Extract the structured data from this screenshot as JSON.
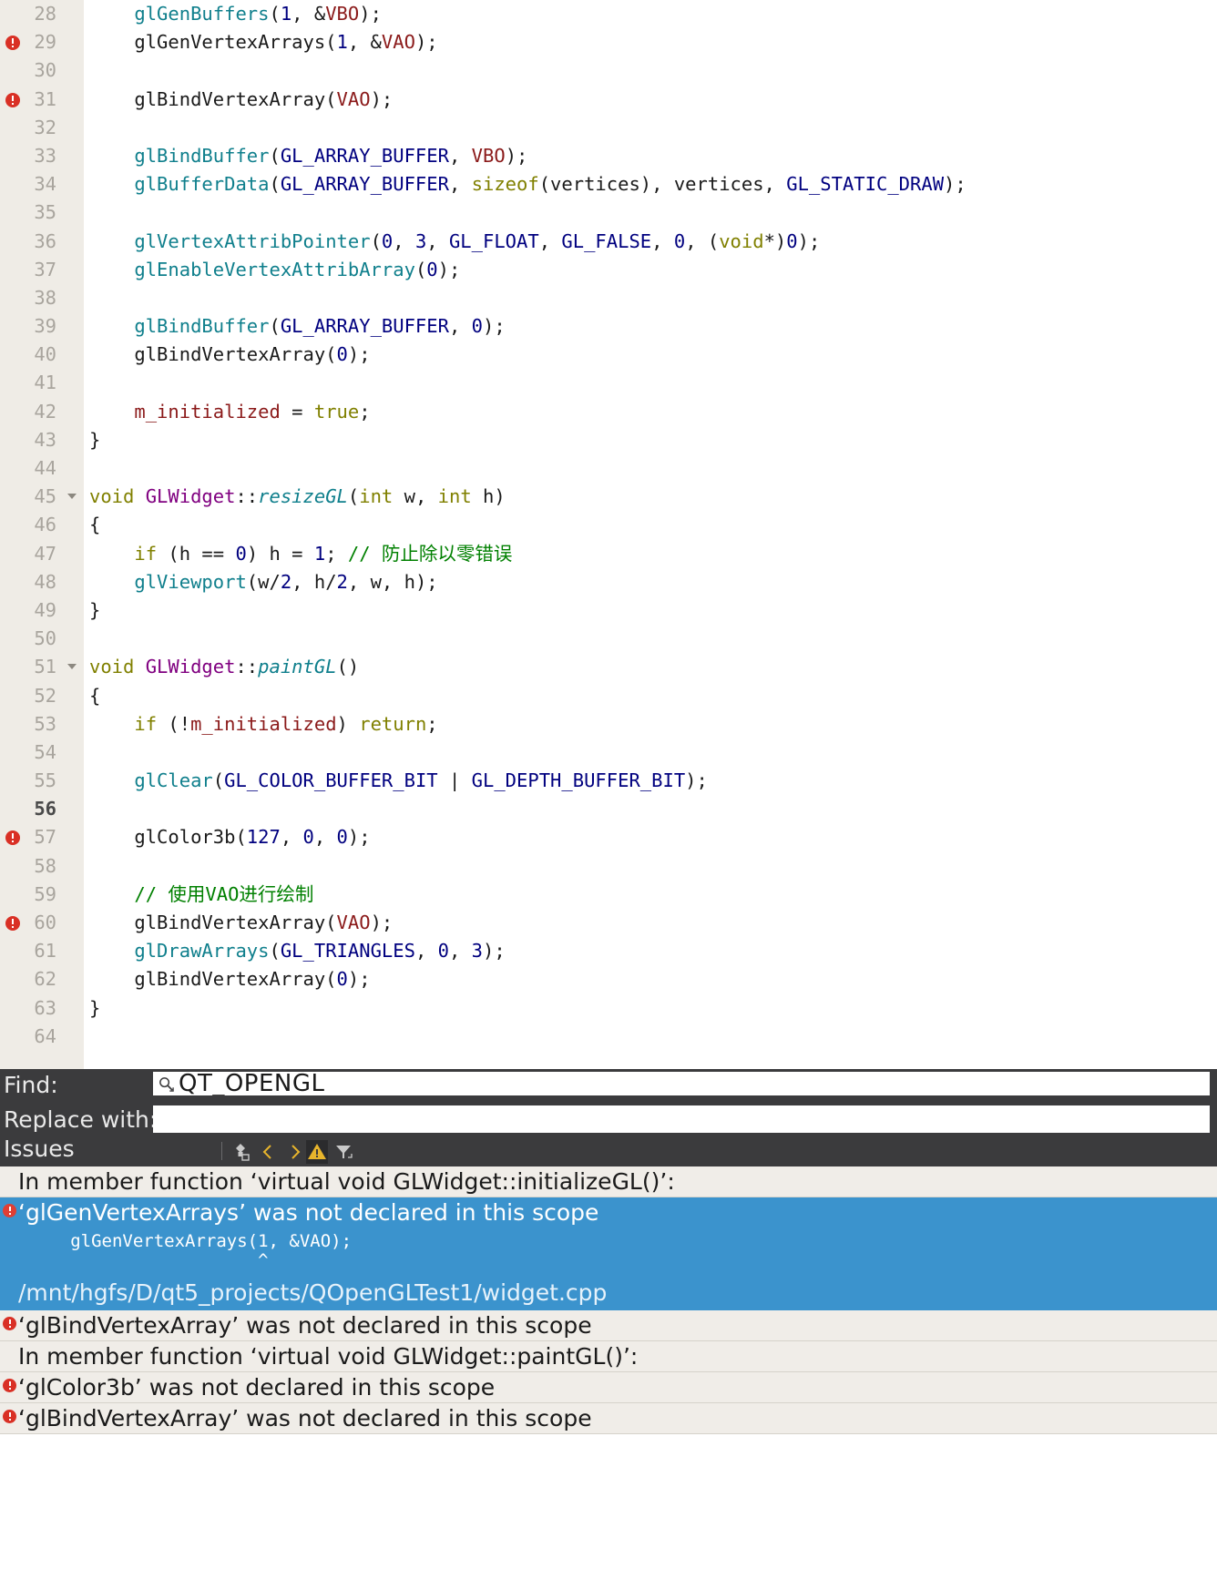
{
  "editor": {
    "first_line": 28,
    "current_line": 56,
    "error_lines": [
      29,
      31,
      57,
      60
    ],
    "fold_lines": [
      45,
      51
    ],
    "lines": [
      {
        "n": 28,
        "segs": [
          {
            "t": "    ",
            "c": "pl"
          },
          {
            "t": "glGenBuffers",
            "c": "gl"
          },
          {
            "t": "(",
            "c": "pl"
          },
          {
            "t": "1",
            "c": "num"
          },
          {
            "t": ", &",
            "c": "pl"
          },
          {
            "t": "VBO",
            "c": "var"
          },
          {
            "t": ");",
            "c": "pl"
          }
        ]
      },
      {
        "n": 29,
        "segs": [
          {
            "t": "    glGenVertexArrays(",
            "c": "pl"
          },
          {
            "t": "1",
            "c": "num"
          },
          {
            "t": ", &",
            "c": "pl"
          },
          {
            "t": "VAO",
            "c": "var"
          },
          {
            "t": ");",
            "c": "pl"
          }
        ]
      },
      {
        "n": 30,
        "segs": []
      },
      {
        "n": 31,
        "segs": [
          {
            "t": "    glBindVertexArray(",
            "c": "pl"
          },
          {
            "t": "VAO",
            "c": "var"
          },
          {
            "t": ");",
            "c": "pl"
          }
        ]
      },
      {
        "n": 32,
        "segs": []
      },
      {
        "n": 33,
        "segs": [
          {
            "t": "    ",
            "c": "pl"
          },
          {
            "t": "glBindBuffer",
            "c": "gl"
          },
          {
            "t": "(",
            "c": "pl"
          },
          {
            "t": "GL_ARRAY_BUFFER",
            "c": "mac"
          },
          {
            "t": ", ",
            "c": "pl"
          },
          {
            "t": "VBO",
            "c": "var"
          },
          {
            "t": ");",
            "c": "pl"
          }
        ]
      },
      {
        "n": 34,
        "segs": [
          {
            "t": "    ",
            "c": "pl"
          },
          {
            "t": "glBufferData",
            "c": "gl"
          },
          {
            "t": "(",
            "c": "pl"
          },
          {
            "t": "GL_ARRAY_BUFFER",
            "c": "mac"
          },
          {
            "t": ", ",
            "c": "pl"
          },
          {
            "t": "sizeof",
            "c": "k"
          },
          {
            "t": "(vertices), vertices, ",
            "c": "pl"
          },
          {
            "t": "GL_STATIC_DRAW",
            "c": "mac"
          },
          {
            "t": ");",
            "c": "pl"
          }
        ]
      },
      {
        "n": 35,
        "segs": []
      },
      {
        "n": 36,
        "segs": [
          {
            "t": "    ",
            "c": "pl"
          },
          {
            "t": "glVertexAttribPointer",
            "c": "gl"
          },
          {
            "t": "(",
            "c": "pl"
          },
          {
            "t": "0",
            "c": "num"
          },
          {
            "t": ", ",
            "c": "pl"
          },
          {
            "t": "3",
            "c": "num"
          },
          {
            "t": ", ",
            "c": "pl"
          },
          {
            "t": "GL_FLOAT",
            "c": "mac"
          },
          {
            "t": ", ",
            "c": "pl"
          },
          {
            "t": "GL_FALSE",
            "c": "mac"
          },
          {
            "t": ", ",
            "c": "pl"
          },
          {
            "t": "0",
            "c": "num"
          },
          {
            "t": ", (",
            "c": "pl"
          },
          {
            "t": "void",
            "c": "cast"
          },
          {
            "t": "*)",
            "c": "pl"
          },
          {
            "t": "0",
            "c": "num"
          },
          {
            "t": ");",
            "c": "pl"
          }
        ]
      },
      {
        "n": 37,
        "segs": [
          {
            "t": "    ",
            "c": "pl"
          },
          {
            "t": "glEnableVertexAttribArray",
            "c": "gl"
          },
          {
            "t": "(",
            "c": "pl"
          },
          {
            "t": "0",
            "c": "num"
          },
          {
            "t": ");",
            "c": "pl"
          }
        ]
      },
      {
        "n": 38,
        "segs": []
      },
      {
        "n": 39,
        "segs": [
          {
            "t": "    ",
            "c": "pl"
          },
          {
            "t": "glBindBuffer",
            "c": "gl"
          },
          {
            "t": "(",
            "c": "pl"
          },
          {
            "t": "GL_ARRAY_BUFFER",
            "c": "mac"
          },
          {
            "t": ", ",
            "c": "pl"
          },
          {
            "t": "0",
            "c": "num"
          },
          {
            "t": ");",
            "c": "pl"
          }
        ]
      },
      {
        "n": 40,
        "segs": [
          {
            "t": "    glBindVertexArray(",
            "c": "pl"
          },
          {
            "t": "0",
            "c": "num"
          },
          {
            "t": ");",
            "c": "pl"
          }
        ]
      },
      {
        "n": 41,
        "segs": []
      },
      {
        "n": 42,
        "segs": [
          {
            "t": "    ",
            "c": "pl"
          },
          {
            "t": "m_initialized",
            "c": "var"
          },
          {
            "t": " = ",
            "c": "pl"
          },
          {
            "t": "true",
            "c": "k"
          },
          {
            "t": ";",
            "c": "pl"
          }
        ]
      },
      {
        "n": 43,
        "segs": [
          {
            "t": "}",
            "c": "pl"
          }
        ]
      },
      {
        "n": 44,
        "segs": []
      },
      {
        "n": 45,
        "segs": [
          {
            "t": "void",
            "c": "k"
          },
          {
            "t": " ",
            "c": "pl"
          },
          {
            "t": "GLWidget",
            "c": "cls"
          },
          {
            "t": "::",
            "c": "pl"
          },
          {
            "t": "resizeGL",
            "c": "fn"
          },
          {
            "t": "(",
            "c": "pl"
          },
          {
            "t": "int",
            "c": "k"
          },
          {
            "t": " w, ",
            "c": "pl"
          },
          {
            "t": "int",
            "c": "k"
          },
          {
            "t": " h)",
            "c": "pl"
          }
        ]
      },
      {
        "n": 46,
        "segs": [
          {
            "t": "{",
            "c": "pl"
          }
        ]
      },
      {
        "n": 47,
        "segs": [
          {
            "t": "    ",
            "c": "pl"
          },
          {
            "t": "if",
            "c": "k"
          },
          {
            "t": " (h == ",
            "c": "pl"
          },
          {
            "t": "0",
            "c": "num"
          },
          {
            "t": ") h = ",
            "c": "pl"
          },
          {
            "t": "1",
            "c": "num"
          },
          {
            "t": "; ",
            "c": "pl"
          },
          {
            "t": "// 防止除以零错误",
            "c": "cmt"
          }
        ]
      },
      {
        "n": 48,
        "segs": [
          {
            "t": "    ",
            "c": "pl"
          },
          {
            "t": "glViewport",
            "c": "gl"
          },
          {
            "t": "(w/",
            "c": "pl"
          },
          {
            "t": "2",
            "c": "num"
          },
          {
            "t": ", h/",
            "c": "pl"
          },
          {
            "t": "2",
            "c": "num"
          },
          {
            "t": ", w, h);",
            "c": "pl"
          }
        ]
      },
      {
        "n": 49,
        "segs": [
          {
            "t": "}",
            "c": "pl"
          }
        ]
      },
      {
        "n": 50,
        "segs": []
      },
      {
        "n": 51,
        "segs": [
          {
            "t": "void",
            "c": "k"
          },
          {
            "t": " ",
            "c": "pl"
          },
          {
            "t": "GLWidget",
            "c": "cls"
          },
          {
            "t": "::",
            "c": "pl"
          },
          {
            "t": "paintGL",
            "c": "fn"
          },
          {
            "t": "()",
            "c": "pl"
          }
        ]
      },
      {
        "n": 52,
        "segs": [
          {
            "t": "{",
            "c": "pl"
          }
        ]
      },
      {
        "n": 53,
        "segs": [
          {
            "t": "    ",
            "c": "pl"
          },
          {
            "t": "if",
            "c": "k"
          },
          {
            "t": " (!",
            "c": "pl"
          },
          {
            "t": "m_initialized",
            "c": "var"
          },
          {
            "t": ") ",
            "c": "pl"
          },
          {
            "t": "return",
            "c": "k"
          },
          {
            "t": ";",
            "c": "pl"
          }
        ]
      },
      {
        "n": 54,
        "segs": []
      },
      {
        "n": 55,
        "segs": [
          {
            "t": "    ",
            "c": "pl"
          },
          {
            "t": "glClear",
            "c": "gl"
          },
          {
            "t": "(",
            "c": "pl"
          },
          {
            "t": "GL_COLOR_BUFFER_BIT",
            "c": "mac"
          },
          {
            "t": " | ",
            "c": "pl"
          },
          {
            "t": "GL_DEPTH_BUFFER_BIT",
            "c": "mac"
          },
          {
            "t": ");",
            "c": "pl"
          }
        ]
      },
      {
        "n": 56,
        "segs": []
      },
      {
        "n": 57,
        "segs": [
          {
            "t": "    glColor3b(",
            "c": "pl"
          },
          {
            "t": "127",
            "c": "num"
          },
          {
            "t": ", ",
            "c": "pl"
          },
          {
            "t": "0",
            "c": "num"
          },
          {
            "t": ", ",
            "c": "pl"
          },
          {
            "t": "0",
            "c": "num"
          },
          {
            "t": ");",
            "c": "pl"
          }
        ]
      },
      {
        "n": 58,
        "segs": []
      },
      {
        "n": 59,
        "segs": [
          {
            "t": "    ",
            "c": "pl"
          },
          {
            "t": "// 使用VAO进行绘制",
            "c": "cmt"
          }
        ]
      },
      {
        "n": 60,
        "segs": [
          {
            "t": "    glBindVertexArray(",
            "c": "pl"
          },
          {
            "t": "VAO",
            "c": "var"
          },
          {
            "t": ");",
            "c": "pl"
          }
        ]
      },
      {
        "n": 61,
        "segs": [
          {
            "t": "    ",
            "c": "pl"
          },
          {
            "t": "glDrawArrays",
            "c": "gl"
          },
          {
            "t": "(",
            "c": "pl"
          },
          {
            "t": "GL_TRIANGLES",
            "c": "mac"
          },
          {
            "t": ", ",
            "c": "pl"
          },
          {
            "t": "0",
            "c": "num"
          },
          {
            "t": ", ",
            "c": "pl"
          },
          {
            "t": "3",
            "c": "num"
          },
          {
            "t": ");",
            "c": "pl"
          }
        ]
      },
      {
        "n": 62,
        "segs": [
          {
            "t": "    glBindVertexArray(",
            "c": "pl"
          },
          {
            "t": "0",
            "c": "num"
          },
          {
            "t": ");",
            "c": "pl"
          }
        ]
      },
      {
        "n": 63,
        "segs": [
          {
            "t": "}",
            "c": "pl"
          }
        ]
      },
      {
        "n": 64,
        "segs": []
      }
    ]
  },
  "find_bar": {
    "find_label": "Find:",
    "find_value": "QT_OPENGL",
    "find_icon": "search-icon",
    "replace_label": "Replace with:",
    "replace_value": ""
  },
  "issues_panel": {
    "title": "Issues",
    "toolbar": [
      {
        "name": "clear-icon",
        "label": "Clear"
      },
      {
        "name": "chevron-left-icon",
        "label": "Previous Item"
      },
      {
        "name": "chevron-right-icon",
        "label": "Next Item"
      },
      {
        "name": "warning-triangle-icon",
        "label": "Show Warnings",
        "active": true
      },
      {
        "name": "filter-icon",
        "label": "Filter"
      }
    ],
    "rows": [
      {
        "kind": "context",
        "text": "In member function ‘virtual void GLWidget::initializeGL()’:",
        "icon": null
      },
      {
        "kind": "error-selected",
        "text": "‘glGenVertexArrays’ was not declared in this scope",
        "icon": "error-icon",
        "code": "     glGenVertexArrays(1, &VAO);",
        "caret": "                       ^",
        "path": "/mnt/hgfs/D/qt5_projects/QOpenGLTest1/widget.cpp"
      },
      {
        "kind": "error",
        "text": "‘glBindVertexArray’ was not declared in this scope",
        "icon": "error-icon"
      },
      {
        "kind": "context",
        "text": "In member function ‘virtual void GLWidget::paintGL()’:",
        "icon": null
      },
      {
        "kind": "error",
        "text": "‘glColor3b’ was not declared in this scope",
        "icon": "error-icon"
      },
      {
        "kind": "error",
        "text": "‘glBindVertexArray’ was not declared in this scope",
        "icon": "error-icon"
      }
    ]
  },
  "colors": {
    "gutter_bg": "#efece6",
    "editor_bg": "#ffffff",
    "panel_bg": "#3b3b3d",
    "issues_bg": "#f0ede8",
    "selection_bg": "#3b93cd",
    "error_red": "#d93025",
    "warning_yellow": "#e8b52c",
    "keyword": "#808000",
    "class_name": "#800080",
    "function": "#0f7f8c",
    "macro": "#00007f",
    "number": "#00007f",
    "variable": "#8b1a1a",
    "comment": "#008000"
  }
}
